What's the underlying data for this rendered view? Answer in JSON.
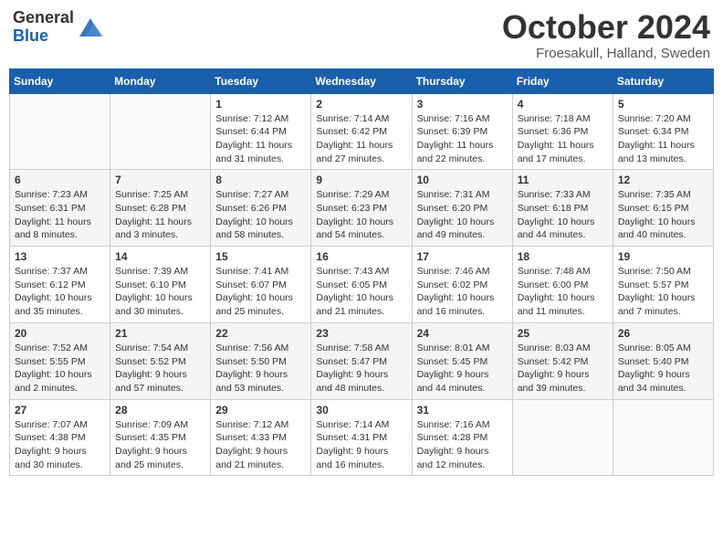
{
  "logo": {
    "general": "General",
    "blue": "Blue"
  },
  "header": {
    "month": "October 2024",
    "location": "Froesakull, Halland, Sweden"
  },
  "days_of_week": [
    "Sunday",
    "Monday",
    "Tuesday",
    "Wednesday",
    "Thursday",
    "Friday",
    "Saturday"
  ],
  "weeks": [
    [
      {
        "day": "",
        "info": ""
      },
      {
        "day": "",
        "info": ""
      },
      {
        "day": "1",
        "info": "Sunrise: 7:12 AM\nSunset: 6:44 PM\nDaylight: 11 hours and 31 minutes."
      },
      {
        "day": "2",
        "info": "Sunrise: 7:14 AM\nSunset: 6:42 PM\nDaylight: 11 hours and 27 minutes."
      },
      {
        "day": "3",
        "info": "Sunrise: 7:16 AM\nSunset: 6:39 PM\nDaylight: 11 hours and 22 minutes."
      },
      {
        "day": "4",
        "info": "Sunrise: 7:18 AM\nSunset: 6:36 PM\nDaylight: 11 hours and 17 minutes."
      },
      {
        "day": "5",
        "info": "Sunrise: 7:20 AM\nSunset: 6:34 PM\nDaylight: 11 hours and 13 minutes."
      }
    ],
    [
      {
        "day": "6",
        "info": "Sunrise: 7:23 AM\nSunset: 6:31 PM\nDaylight: 11 hours and 8 minutes."
      },
      {
        "day": "7",
        "info": "Sunrise: 7:25 AM\nSunset: 6:28 PM\nDaylight: 11 hours and 3 minutes."
      },
      {
        "day": "8",
        "info": "Sunrise: 7:27 AM\nSunset: 6:26 PM\nDaylight: 10 hours and 58 minutes."
      },
      {
        "day": "9",
        "info": "Sunrise: 7:29 AM\nSunset: 6:23 PM\nDaylight: 10 hours and 54 minutes."
      },
      {
        "day": "10",
        "info": "Sunrise: 7:31 AM\nSunset: 6:20 PM\nDaylight: 10 hours and 49 minutes."
      },
      {
        "day": "11",
        "info": "Sunrise: 7:33 AM\nSunset: 6:18 PM\nDaylight: 10 hours and 44 minutes."
      },
      {
        "day": "12",
        "info": "Sunrise: 7:35 AM\nSunset: 6:15 PM\nDaylight: 10 hours and 40 minutes."
      }
    ],
    [
      {
        "day": "13",
        "info": "Sunrise: 7:37 AM\nSunset: 6:12 PM\nDaylight: 10 hours and 35 minutes."
      },
      {
        "day": "14",
        "info": "Sunrise: 7:39 AM\nSunset: 6:10 PM\nDaylight: 10 hours and 30 minutes."
      },
      {
        "day": "15",
        "info": "Sunrise: 7:41 AM\nSunset: 6:07 PM\nDaylight: 10 hours and 25 minutes."
      },
      {
        "day": "16",
        "info": "Sunrise: 7:43 AM\nSunset: 6:05 PM\nDaylight: 10 hours and 21 minutes."
      },
      {
        "day": "17",
        "info": "Sunrise: 7:46 AM\nSunset: 6:02 PM\nDaylight: 10 hours and 16 minutes."
      },
      {
        "day": "18",
        "info": "Sunrise: 7:48 AM\nSunset: 6:00 PM\nDaylight: 10 hours and 11 minutes."
      },
      {
        "day": "19",
        "info": "Sunrise: 7:50 AM\nSunset: 5:57 PM\nDaylight: 10 hours and 7 minutes."
      }
    ],
    [
      {
        "day": "20",
        "info": "Sunrise: 7:52 AM\nSunset: 5:55 PM\nDaylight: 10 hours and 2 minutes."
      },
      {
        "day": "21",
        "info": "Sunrise: 7:54 AM\nSunset: 5:52 PM\nDaylight: 9 hours and 57 minutes."
      },
      {
        "day": "22",
        "info": "Sunrise: 7:56 AM\nSunset: 5:50 PM\nDaylight: 9 hours and 53 minutes."
      },
      {
        "day": "23",
        "info": "Sunrise: 7:58 AM\nSunset: 5:47 PM\nDaylight: 9 hours and 48 minutes."
      },
      {
        "day": "24",
        "info": "Sunrise: 8:01 AM\nSunset: 5:45 PM\nDaylight: 9 hours and 44 minutes."
      },
      {
        "day": "25",
        "info": "Sunrise: 8:03 AM\nSunset: 5:42 PM\nDaylight: 9 hours and 39 minutes."
      },
      {
        "day": "26",
        "info": "Sunrise: 8:05 AM\nSunset: 5:40 PM\nDaylight: 9 hours and 34 minutes."
      }
    ],
    [
      {
        "day": "27",
        "info": "Sunrise: 7:07 AM\nSunset: 4:38 PM\nDaylight: 9 hours and 30 minutes."
      },
      {
        "day": "28",
        "info": "Sunrise: 7:09 AM\nSunset: 4:35 PM\nDaylight: 9 hours and 25 minutes."
      },
      {
        "day": "29",
        "info": "Sunrise: 7:12 AM\nSunset: 4:33 PM\nDaylight: 9 hours and 21 minutes."
      },
      {
        "day": "30",
        "info": "Sunrise: 7:14 AM\nSunset: 4:31 PM\nDaylight: 9 hours and 16 minutes."
      },
      {
        "day": "31",
        "info": "Sunrise: 7:16 AM\nSunset: 4:28 PM\nDaylight: 9 hours and 12 minutes."
      },
      {
        "day": "",
        "info": ""
      },
      {
        "day": "",
        "info": ""
      }
    ]
  ]
}
